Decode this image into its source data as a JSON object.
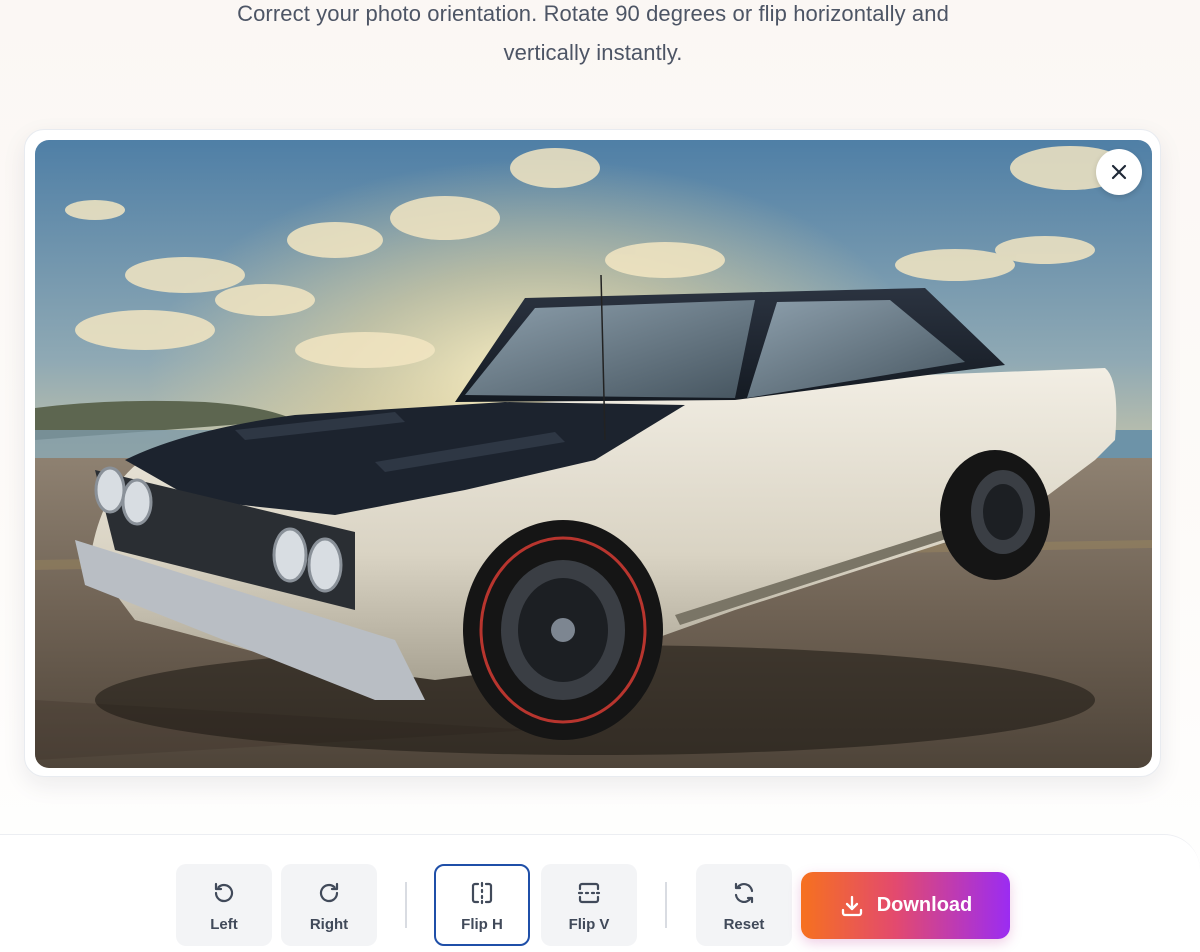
{
  "header": {
    "subtitle_line1": "Correct your photo orientation. Rotate 90 degrees or flip horizontally and",
    "subtitle_line2": "vertically instantly."
  },
  "preview": {
    "image_subject": "classic white muscle car with black roof and hood at sunset",
    "close_icon": "close-icon"
  },
  "toolbar": {
    "rotate_left": {
      "label": "Left",
      "icon": "rotate-left-icon"
    },
    "rotate_right": {
      "label": "Right",
      "icon": "rotate-right-icon"
    },
    "flip_h": {
      "label": "Flip H",
      "icon": "flip-horizontal-icon",
      "active": true
    },
    "flip_v": {
      "label": "Flip V",
      "icon": "flip-vertical-icon"
    },
    "reset": {
      "label": "Reset",
      "icon": "reset-icon"
    },
    "download": {
      "label": "Download",
      "icon": "download-icon"
    }
  },
  "colors": {
    "active_border": "#1f4fa8",
    "download_gradient": [
      "#f6711f",
      "#e34a6e",
      "#9b2cf2"
    ],
    "tool_bg": "#f3f4f6"
  }
}
